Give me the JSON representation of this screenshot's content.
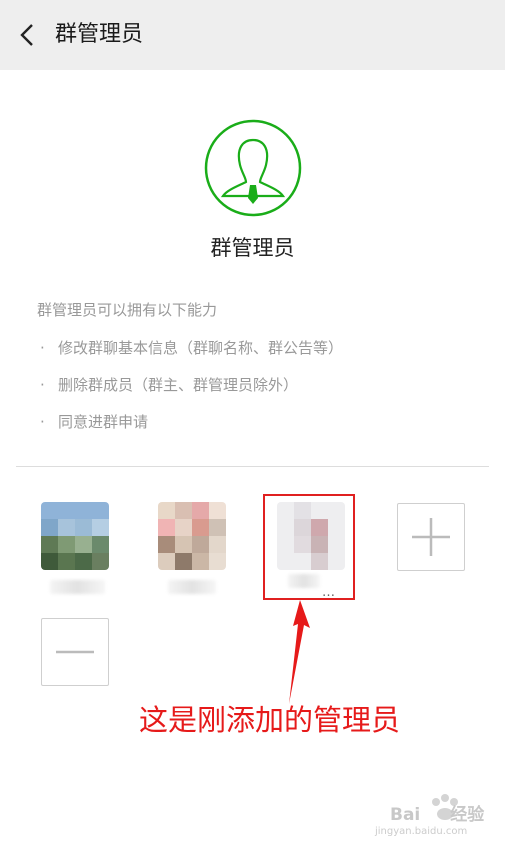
{
  "header": {
    "title": "群管理员"
  },
  "hero": {
    "label": "群管理员"
  },
  "abilities": {
    "intro": "群管理员可以拥有以下能力",
    "items": [
      "修改群聊基本信息（群聊名称、群公告等）",
      "删除群成员（群主、群管理员除外）",
      "同意进群申请"
    ]
  },
  "members": [
    {
      "name": ""
    },
    {
      "name": ""
    },
    {
      "name": "…"
    }
  ],
  "annotation": {
    "text": "这是刚添加的管理员"
  },
  "watermark": {
    "brand": "Bai",
    "brand_cn": "经验",
    "url": "jingyan.baidu.com"
  },
  "colors": {
    "accent_green": "#1aad19",
    "annotation_red": "#e61a1a"
  }
}
